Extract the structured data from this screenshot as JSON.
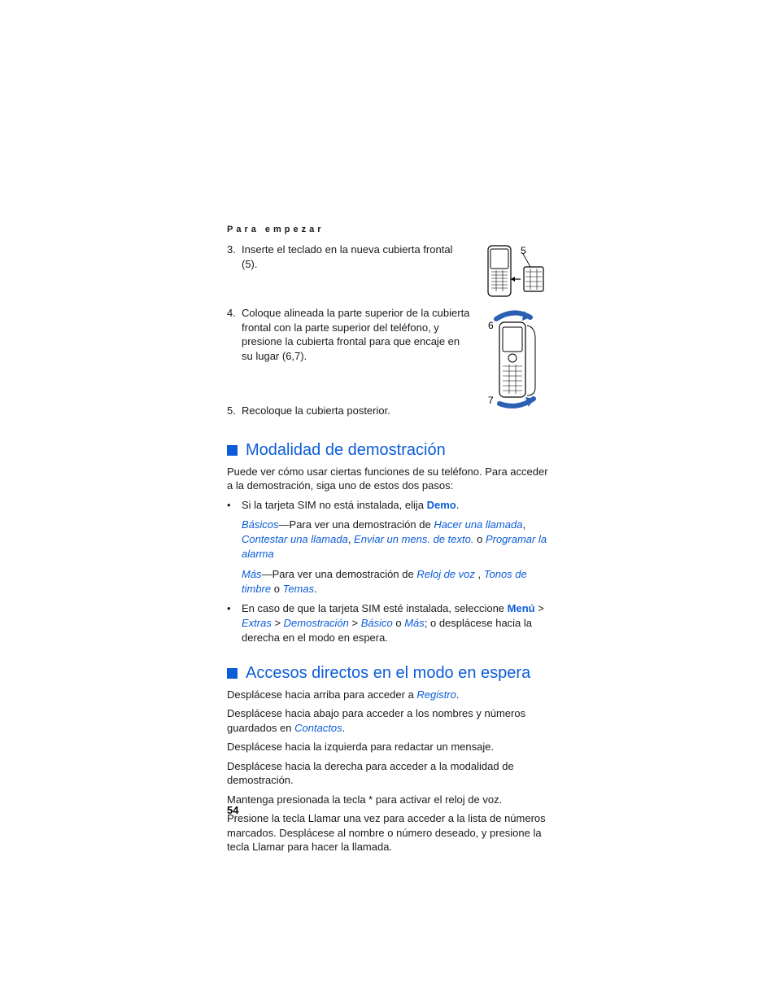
{
  "header": "Para empezar",
  "step3": {
    "num": "3.",
    "text": "Inserte el teclado en la nueva cubierta frontal (5)."
  },
  "fig5": {
    "label5": "5"
  },
  "step4": {
    "num": "4.",
    "text": "Coloque alineada la parte superior de la cubierta frontal con la parte superior del teléfono, y presione la cubierta frontal para que encaje en su lugar (6,7)."
  },
  "fig67": {
    "label6": "6",
    "label7": "7"
  },
  "step5": {
    "num": "5.",
    "text": "Recoloque la cubierta posterior."
  },
  "section1": {
    "title": "Modalidad de demostración",
    "intro": "Puede ver cómo usar ciertas funciones de su teléfono. Para acceder a la demostración, siga uno de estos dos pasos:",
    "b1": {
      "pre": "Si la tarjeta SIM no está instalada, elija ",
      "demo": "Demo",
      "post": "."
    },
    "b1a": {
      "basicos": "Básicos",
      "dash1": "—Para ver una demostración de ",
      "l1": "Hacer una llamada",
      "c1": ", ",
      "l2": "Contestar una llamada",
      "c2": ", ",
      "l3": "Enviar un mens. de texto.",
      "or": " o ",
      "l4": "Programar la alarma"
    },
    "b1b": {
      "mas": "Más",
      "dash1": "—Para ver una demostración de ",
      "l1": "Reloj de voz ",
      "c1": ", ",
      "l2": "Tonos de timbre ",
      "or": " o ",
      "l3": "Temas",
      "post": "."
    },
    "b2": {
      "pre": "En caso de que la tarjeta SIM esté instalada, seleccione ",
      "menu": "Menú",
      "gt1": " > ",
      "extras": "Extras",
      "gt2": " > ",
      "demo": "Demostración",
      "gt3": " > ",
      "basico": "Básico",
      "or": " o ",
      "mas": "Más",
      "post": "; o desplácese hacia la derecha en el modo en espera."
    }
  },
  "section2": {
    "title": "Accesos directos en el modo en espera",
    "p1a": "Desplácese hacia arriba para acceder a ",
    "p1b": "Registro",
    "p1c": ".",
    "p2a": "Desplácese hacia abajo para acceder a los nombres y números guardados en ",
    "p2b": "Contactos",
    "p2c": ".",
    "p3": "Desplácese hacia la izquierda para redactar un mensaje.",
    "p4": "Desplácese hacia la derecha para acceder a la modalidad de demostración.",
    "p5": "Mantenga presionada la tecla * para activar el reloj de voz.",
    "p6": "Presione la tecla Llamar una vez para acceder a la lista de números marcados. Desplácese al nombre o número deseado, y presione la tecla Llamar para hacer la llamada."
  },
  "pageNumber": "54"
}
